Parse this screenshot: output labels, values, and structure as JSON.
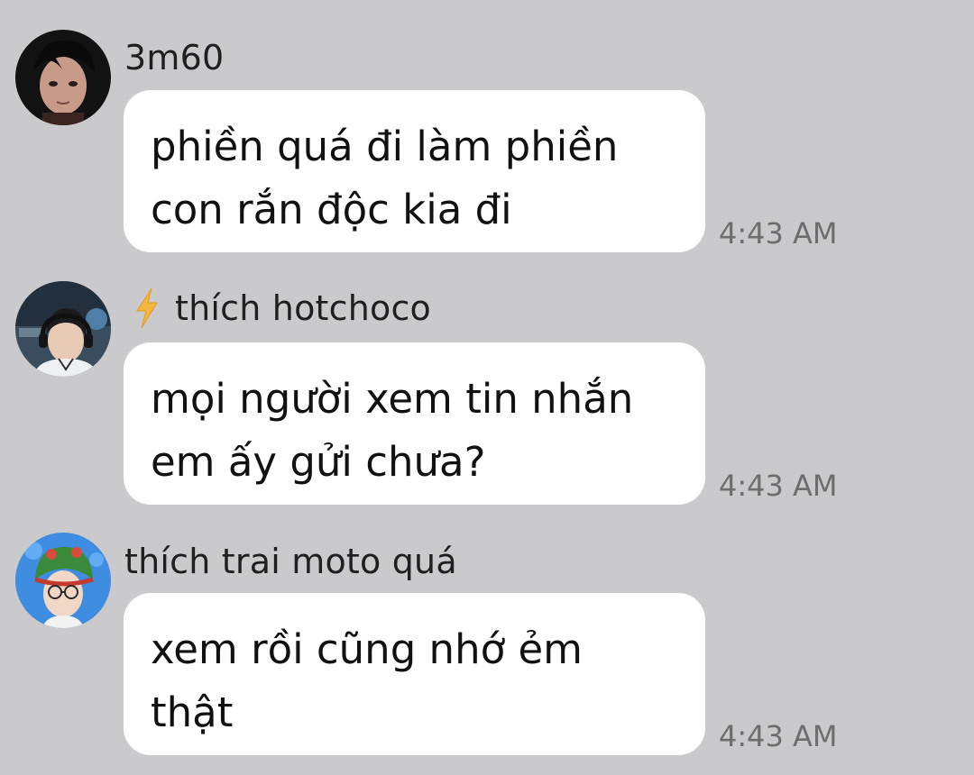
{
  "messages": [
    {
      "sender": "3m60",
      "text": "phiền quá đi làm phiền\ncon rắn độc kia đi",
      "time": "4:43 AM",
      "avatar": "avatar-icon"
    },
    {
      "sender": "thích hotchoco",
      "text": "mọi người xem tin nhắn\nem ấy gửi chưa?",
      "time": "4:43 AM",
      "avatar": "avatar-icon",
      "badge_icon": "lightning-icon"
    },
    {
      "sender": "thích trai moto quá",
      "text": "xem rồi cũng nhớ ẻm\nthật",
      "time": "4:43 AM",
      "avatar": "avatar-icon"
    }
  ],
  "colors": {
    "background": "#cacacc",
    "bubble": "#ffffff",
    "timestamp": "#6d6d6d",
    "lightning": "#f5b640"
  }
}
